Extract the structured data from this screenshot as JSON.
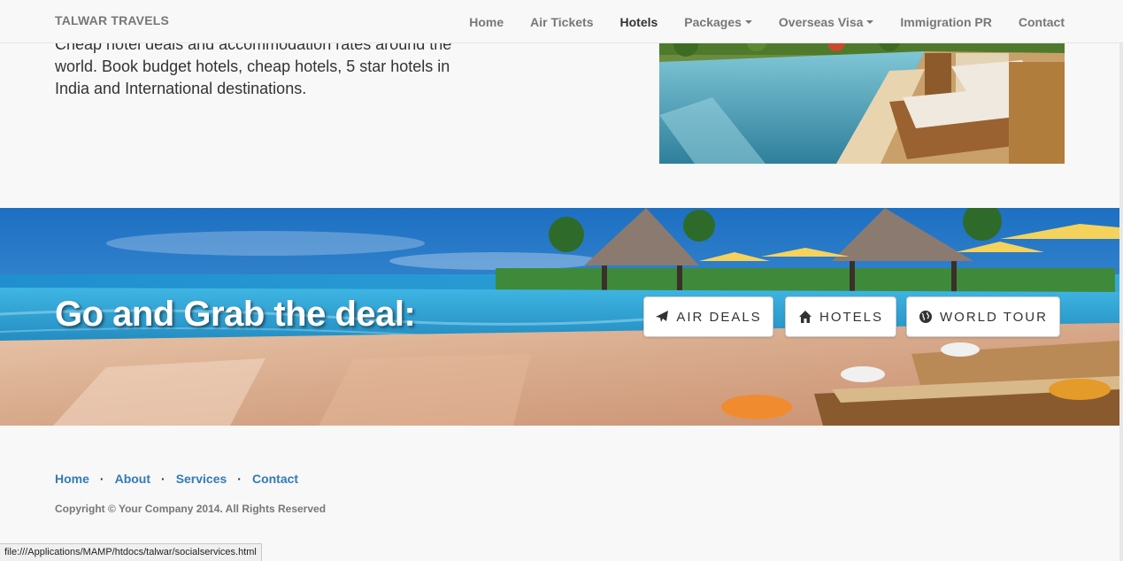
{
  "navbar": {
    "brand": "TALWAR TRAVELS",
    "items": [
      {
        "label": "Home",
        "dropdown": false,
        "active": false
      },
      {
        "label": "Air Tickets",
        "dropdown": false,
        "active": false
      },
      {
        "label": "Hotels",
        "dropdown": false,
        "active": true
      },
      {
        "label": "Packages",
        "dropdown": true,
        "active": false
      },
      {
        "label": "Overseas Visa",
        "dropdown": true,
        "active": false
      },
      {
        "label": "Immigration PR",
        "dropdown": false,
        "active": false
      },
      {
        "label": "Contact",
        "dropdown": false,
        "active": false
      }
    ]
  },
  "intro": {
    "text": "Cheap hotel deals and accommodation rates around the world. Book budget hotels, cheap hotels, 5 star hotels in India and International destinations."
  },
  "banner": {
    "title": "Go and Grab the deal:",
    "buttons": [
      {
        "label": "AIR DEALS",
        "icon": "plane-icon"
      },
      {
        "label": "HOTELS",
        "icon": "home-icon"
      },
      {
        "label": "WORLD TOUR",
        "icon": "globe-icon"
      }
    ]
  },
  "footer": {
    "links": [
      "Home",
      "About",
      "Services",
      "Contact"
    ],
    "copyright": "Copyright © Your Company 2014. All Rights Reserved"
  },
  "statusbar": {
    "url": "file:///Applications/MAMP/htdocs/talwar/socialservices.html"
  },
  "colors": {
    "link": "#337ab7",
    "nav_text": "#777777",
    "nav_active": "#333333",
    "background": "#f8f8f8"
  }
}
